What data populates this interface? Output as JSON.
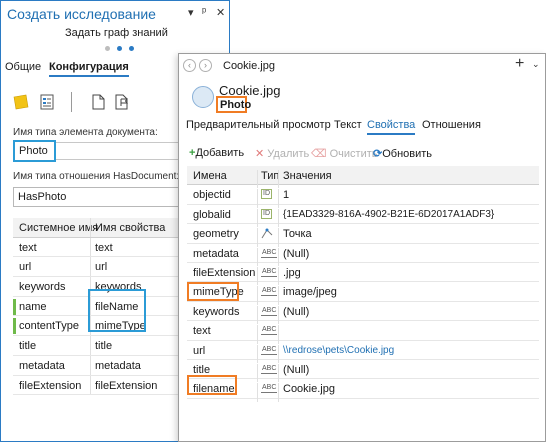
{
  "left": {
    "title": "Создать исследование",
    "controls": [
      "▾",
      "ᵖ",
      "✕"
    ],
    "subtitle": "Задать граф знаний",
    "step_colors": [
      "#bdbdbd",
      "#2b7bc4",
      "#2b7bc4"
    ],
    "tabs": [
      "Общие",
      "Конфигурация"
    ],
    "tool_icons": [
      "sticky-note-icon",
      "document-list-icon",
      "document-icon",
      "flag-document-icon"
    ],
    "doc_type_label": "Имя типа элемента документа:",
    "doc_type_value": "Photo",
    "rel_type_label": "Имя типа отношения HasDocument:",
    "rel_type_value": "HasPhoto",
    "mapping": {
      "headers": [
        "Системное имя",
        "Имя свойства"
      ],
      "rows": [
        [
          "text",
          "text"
        ],
        [
          "url",
          "url"
        ],
        [
          "keywords",
          "keywords"
        ],
        [
          "name",
          "fileName"
        ],
        [
          "contentType",
          "mimeType"
        ],
        [
          "title",
          "title"
        ],
        [
          "metadata",
          "metadata"
        ],
        [
          "fileExtension",
          "fileExtension"
        ]
      ]
    }
  },
  "right": {
    "title": "Cookie.jpg",
    "plus": "+",
    "chevron": "⌄",
    "name": "Cookie.jpg",
    "type": "Photo",
    "tabs": [
      "Предварительный просмотр",
      "Текст",
      "Свойства",
      "Отношения"
    ],
    "active_tab": "Свойства",
    "toolbar": {
      "add": "Добавить",
      "delete": "Удалить",
      "clear": "Очистить",
      "refresh": "Обновить"
    },
    "table": {
      "headers": [
        "Имена",
        "Тип",
        "Значения"
      ],
      "rows": [
        {
          "name": "objectid",
          "type": "id",
          "value": "1"
        },
        {
          "name": "globalid",
          "type": "id",
          "value": "{1EAD3329-816A-4902-B21E-6D2017A1ADF3}"
        },
        {
          "name": "geometry",
          "type": "geom",
          "value": "Точка"
        },
        {
          "name": "metadata",
          "type": "abc",
          "value": "(Null)"
        },
        {
          "name": "fileExtension",
          "type": "abc",
          "value": ".jpg"
        },
        {
          "name": "mimeType",
          "type": "abc",
          "value": "image/jpeg"
        },
        {
          "name": "keywords",
          "type": "abc",
          "value": "(Null)"
        },
        {
          "name": "text",
          "type": "abc",
          "value": ""
        },
        {
          "name": "url",
          "type": "abc",
          "value": "\\\\redrose\\pets\\Cookie.jpg"
        },
        {
          "name": "title",
          "type": "abc",
          "value": "(Null)"
        },
        {
          "name": "filename",
          "type": "abc",
          "value": "Cookie.jpg"
        }
      ]
    },
    "type_badges": {
      "id": "ID",
      "abc": "ABC"
    }
  },
  "colors": {
    "accent": "#2b7bc4",
    "highlight_blue": "#2b9bd6",
    "highlight_orange": "#f07c24",
    "green": "#6fba4a",
    "disabled": "#b0b0b0"
  }
}
